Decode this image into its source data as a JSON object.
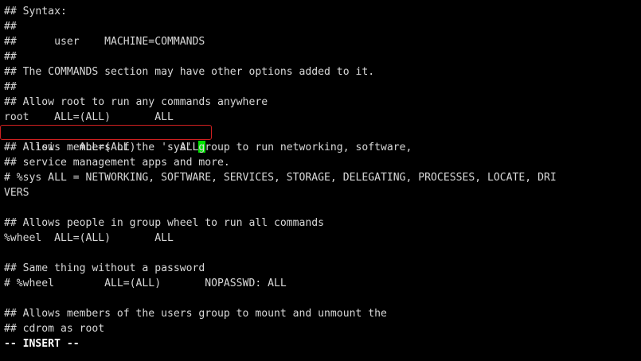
{
  "editor": {
    "lines": [
      "## Syntax:",
      "##",
      "##      user    MACHINE=COMMANDS",
      "##",
      "## The COMMANDS section may have other options added to it.",
      "##",
      "## Allow root to run any commands anywhere",
      "root    ALL=(ALL)       ALL",
      "lisi    ALL=(ALL)       ALL",
      "## Allows members of the 'sys' group to run networking, software,",
      "## service management apps and more.",
      "# %sys ALL = NETWORKING, SOFTWARE, SERVICES, STORAGE, DELEGATING, PROCESSES, LOCATE, DRI",
      "VERS",
      "",
      "## Allows people in group wheel to run all commands",
      "%wheel  ALL=(ALL)       ALL",
      "",
      "## Same thing without a password",
      "# %wheel        ALL=(ALL)       NOPASSWD: ALL",
      "",
      "## Allows members of the users group to mount and unmount the",
      "## cdrom as root"
    ],
    "mode_indicator": "-- INSERT --"
  },
  "colors": {
    "background": "#000000",
    "text": "#d8d8d8",
    "cursor": "#00e000",
    "highlight_border": "#d02020"
  }
}
